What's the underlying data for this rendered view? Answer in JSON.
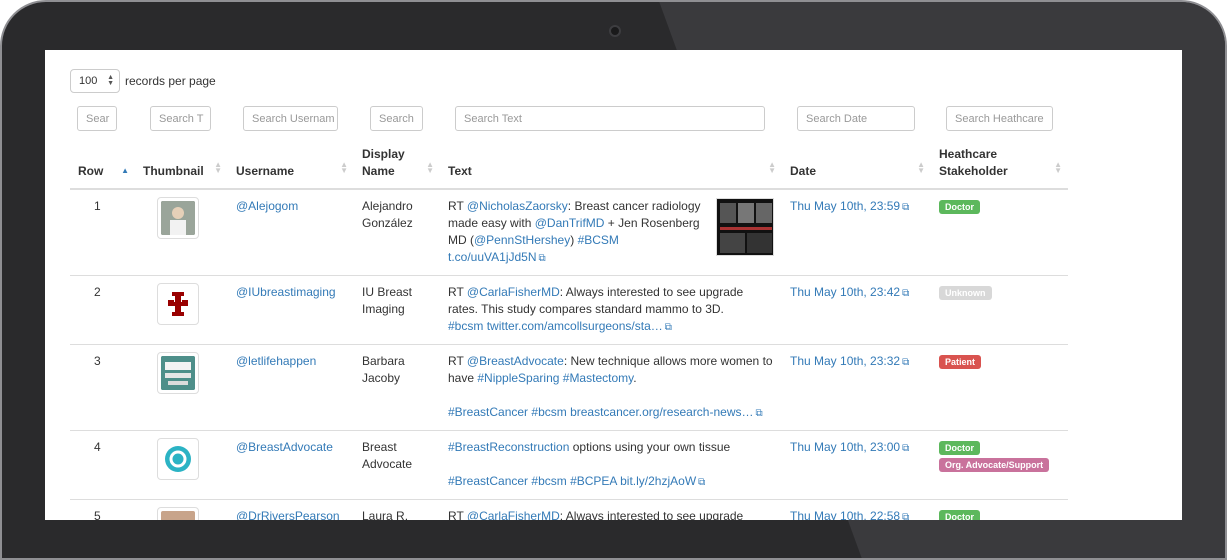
{
  "toolbar": {
    "records_value": "100",
    "records_label": "records per page"
  },
  "search": {
    "row": "Sear",
    "thumbnail": "Search T",
    "username": "Search Usernam",
    "display_name": "Search",
    "text": "Search Text",
    "date": "Search Date",
    "healthcare": "Search Heathcare"
  },
  "columns": {
    "row": "Row",
    "thumbnail": "Thumbnail",
    "username": "Username",
    "display_name_1": "Display",
    "display_name_2": "Name",
    "text": "Text",
    "date": "Date",
    "stakeholder_1": "Heathcare",
    "stakeholder_2": "Stakeholder"
  },
  "rows": [
    {
      "num": "1",
      "username": "@Alejogom",
      "name_1": "Alejandro",
      "name_2": "González",
      "text": {
        "p1": "RT ",
        "m1": "@NicholasZaorsky",
        "p2": ": Breast cancer radiology made easy with ",
        "m2": "@DanTrifMD",
        "p3": " + Jen Rosenberg MD (",
        "m3": "@PennStHershey",
        "p4": ") ",
        "h1": "#BCSM",
        "url": "t.co/uuVA1jJd5N"
      },
      "date": "Thu May 10th, 23:59",
      "badges": [
        {
          "label": "Doctor",
          "kind": "doctor"
        }
      ]
    },
    {
      "num": "2",
      "username": "@IUbreastimaging",
      "name_1": "IU Breast",
      "name_2": "Imaging",
      "text": {
        "p1": "RT ",
        "m1": "@CarlaFisherMD",
        "p2": ": Always interested to see upgrade rates. This study compares standard mammo to 3D.",
        "h1": "#bcsm",
        "url": "twitter.com/amcollsurgeons/sta…"
      },
      "date": "Thu May 10th, 23:42",
      "badges": [
        {
          "label": "Unknown",
          "kind": "unknown"
        }
      ]
    },
    {
      "num": "3",
      "username": "@letlifehappen",
      "name_1": "Barbara",
      "name_2": "Jacoby",
      "text": {
        "p1": "RT ",
        "m1": "@BreastAdvocate",
        "p2": ": New technique allows more women to have ",
        "h1": "#NippleSparing",
        "h2": "#Mastectomy",
        "p3": ".",
        "h3": "#BreastCancer",
        "h4": "#bcsm",
        "url": "breastcancer.org/research-news…"
      },
      "date": "Thu May 10th, 23:32",
      "badges": [
        {
          "label": "Patient",
          "kind": "patient"
        }
      ]
    },
    {
      "num": "4",
      "username": "@BreastAdvocate",
      "name_1": "Breast",
      "name_2": "Advocate",
      "text": {
        "h1": "#BreastReconstruction",
        "p1": " options using your own tissue",
        "h2": "#BreastCancer",
        "h3": "#bcsm",
        "h4": "#BCPEA",
        "url": "bit.ly/2hzjAoW"
      },
      "date": "Thu May 10th, 23:00",
      "badges": [
        {
          "label": "Doctor",
          "kind": "doctor"
        },
        {
          "label": "Org. Advocate/Support",
          "kind": "org"
        }
      ]
    },
    {
      "num": "5",
      "username": "@DrRiversPearson",
      "name_1": "Laura R.",
      "text": {
        "p1": "RT ",
        "m1": "@CarlaFisherMD",
        "p2": ": Always interested to see upgrade"
      },
      "date": "Thu May 10th, 22:58",
      "badges": [
        {
          "label": "Doctor",
          "kind": "doctor"
        }
      ]
    }
  ],
  "colors": {
    "link": "#337ab7",
    "doctor": "#5cb85c",
    "unknown": "#d8d8d8",
    "patient": "#d9534f",
    "org": "#c9729c"
  },
  "icons": {
    "external_link": "external-link-icon",
    "sort": "sort-icon"
  }
}
